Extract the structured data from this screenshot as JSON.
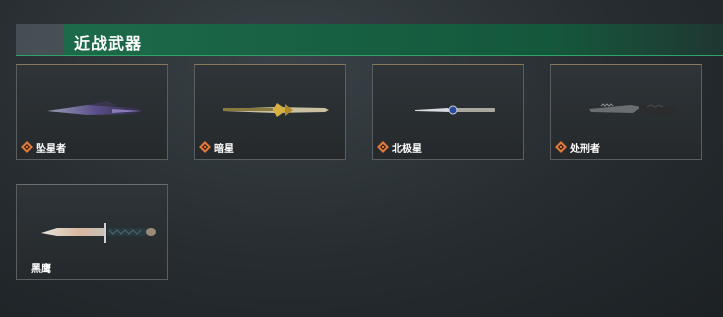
{
  "header": {
    "title": "近战武器"
  },
  "colors": {
    "accent_green": "#1d6a4a",
    "rank_orange": "#e07a3a",
    "card_border": "#5a5e60"
  },
  "weapons": [
    {
      "label": "坠星者",
      "icon": "rank-diamond-icon",
      "image": "purple-blade-knife"
    },
    {
      "label": "暗星",
      "icon": "rank-diamond-icon",
      "image": "gold-winged-knife"
    },
    {
      "label": "北极星",
      "icon": "rank-diamond-icon",
      "image": "blue-gem-knife"
    },
    {
      "label": "处刑者",
      "icon": "rank-diamond-icon",
      "image": "serrated-black-knife"
    },
    {
      "label": "黑鹰",
      "icon": "",
      "image": "bowie-knife"
    }
  ]
}
